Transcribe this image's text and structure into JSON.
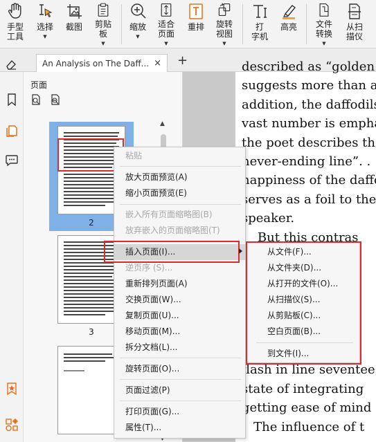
{
  "toolbar": {
    "hand_line1": "手型",
    "hand_line2": "工具",
    "select": "选择",
    "screenshot": "截图",
    "clipboard_line1": "剪贴",
    "clipboard_line2": "板",
    "zoom": "缩放",
    "fit_line1": "适合",
    "fit_line2": "页面",
    "reflow": "重排",
    "rotate_line1": "旋转",
    "rotate_line2": "视图",
    "typewriter_line1": "打",
    "typewriter_line2": "字机",
    "highlight": "高亮",
    "convert_line1": "文件",
    "convert_line2": "转换",
    "scan_line1": "从扫",
    "scan_line2": "描仪"
  },
  "tab": {
    "title": "An Analysis on The Daff...",
    "close": "×",
    "add": "+"
  },
  "panel": {
    "title": "页面",
    "thumbs": [
      {
        "num": "2"
      },
      {
        "num": "3"
      }
    ]
  },
  "document": {
    "lines": [
      "described as “golden",
      "suggests more than a",
      "addition, the daffodils",
      "vast number is empha",
      "the poet describes th",
      "never-ending line”. .",
      "happiness of the daffo",
      "serves as a foil to the",
      "speaker.",
      "    But this contras",
      "                    co",
      "                    e t",
      "                    ate",
      "                    ee",
      "                    t a",
      "                    rej",
      "flash in line seventee",
      "state of integrating",
      "getting ease of mind a",
      "   The influence of t"
    ]
  },
  "context_menu": {
    "items": [
      {
        "label": "粘贴",
        "disabled": true
      },
      {
        "label": "放大页面预览(A)"
      },
      {
        "label": "缩小页面预览(E)"
      },
      {
        "label": "嵌入所有页面缩略图(B)",
        "disabled": true
      },
      {
        "label": "放弃嵌入的页面缩略图(T)",
        "disabled": true
      },
      {
        "label": "插入页面(I)..."
      },
      {
        "label": "逆页序 (S)...",
        "disabled": true
      },
      {
        "label": "重新排列页面(A)"
      },
      {
        "label": "交换页面(W)..."
      },
      {
        "label": "复制页面(U)..."
      },
      {
        "label": "移动页面(M)..."
      },
      {
        "label": "拆分文档(L)..."
      },
      {
        "label": "旋转页面(O)..."
      },
      {
        "label": "页面过滤(P)"
      },
      {
        "label": "打印页面(G)..."
      },
      {
        "label": "属性(T)..."
      }
    ]
  },
  "submenu": {
    "items": [
      {
        "label": "从文件(F)..."
      },
      {
        "label": "从文件夹(D)..."
      },
      {
        "label": "从打开的文件(O)..."
      },
      {
        "label": "从扫描仪(S)..."
      },
      {
        "label": "从剪贴板(C)..."
      },
      {
        "label": "空白页面(B)..."
      },
      {
        "label": "到文件(I)..."
      }
    ]
  },
  "colors": {
    "highlight_red": "#e0292c",
    "selection_blue": "#7fb1e6",
    "accent_orange": "#e8701a"
  },
  "icons": {
    "hand": "hand-icon",
    "select": "cursor-icon",
    "screenshot": "image-crop-icon",
    "clipboard": "clipboard-icon",
    "zoom": "zoom-icon",
    "fit": "fit-page-icon",
    "reflow": "reflow-icon",
    "rotate": "rotate-icon",
    "typewriter": "typewriter-icon",
    "highlight": "highlighter-icon",
    "convert": "file-convert-icon",
    "scan": "scanner-icon"
  }
}
